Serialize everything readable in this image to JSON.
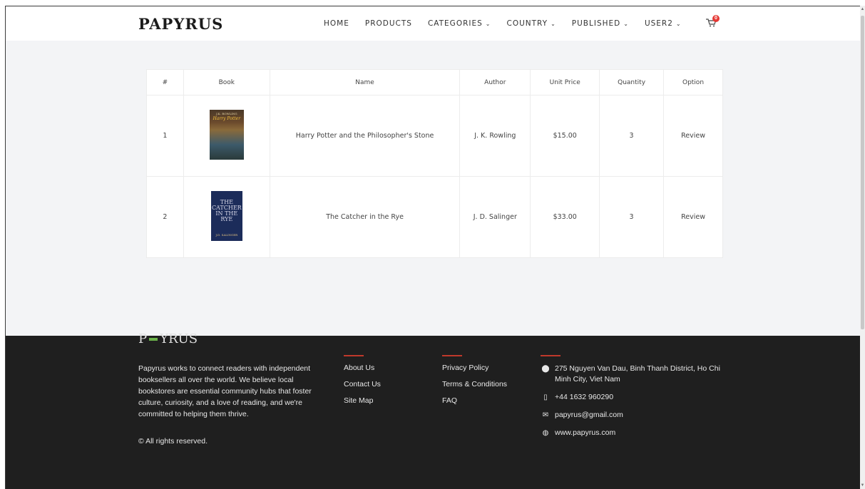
{
  "header": {
    "logo": "PAPYRUS",
    "nav": [
      {
        "label": "HOME",
        "dropdown": false
      },
      {
        "label": "PRODUCTS",
        "dropdown": false
      },
      {
        "label": "CATEGORIES",
        "dropdown": true
      },
      {
        "label": "COUNTRY",
        "dropdown": true
      },
      {
        "label": "PUBLISHED",
        "dropdown": true
      },
      {
        "label": "USER2",
        "dropdown": true
      }
    ],
    "cart_count": "0",
    "chevron": "⌄"
  },
  "table": {
    "headers": [
      "#",
      "Book",
      "Name",
      "Author",
      "Unit Price",
      "Quantity",
      "Option"
    ],
    "rows": [
      {
        "index": "1",
        "cover_text_1": "J.K. ROWLING",
        "cover_text_2": "Harry Potter",
        "name": "Harry Potter and the Philosopher's Stone",
        "author": "J. K. Rowling",
        "price": "$15.00",
        "quantity": "3",
        "option": "Review"
      },
      {
        "index": "2",
        "cover_text_1": "THE CATCHER IN THE RYE",
        "cover_text_2": "J.D. SALINGER",
        "name": "The Catcher in the Rye",
        "author": "J. D. Salinger",
        "price": "$33.00",
        "quantity": "3",
        "option": "Review"
      }
    ]
  },
  "footer": {
    "about": "Papyrus works to connect readers with independent booksellers all over the world. We believe local bookstores are essential community hubs that foster culture, curiosity, and a love of reading, and we're committed to helping them thrive.",
    "copyright": "© All rights reserved.",
    "col1": [
      "About Us",
      "Contact Us",
      "Site Map"
    ],
    "col2": [
      "Privacy Policy",
      "Terms & Conditions",
      "FAQ"
    ],
    "address": "275 Nguyen Van Dau, Binh Thanh District, Ho Chi Minh City, Viet Nam",
    "phone": "+44 1632 960290",
    "email": "papyrus@gmail.com",
    "website": "www.papyrus.com"
  },
  "colors": {
    "footer_bg": "#1f1f1f",
    "accent_red": "#c0392b",
    "badge_red": "#e53935"
  }
}
